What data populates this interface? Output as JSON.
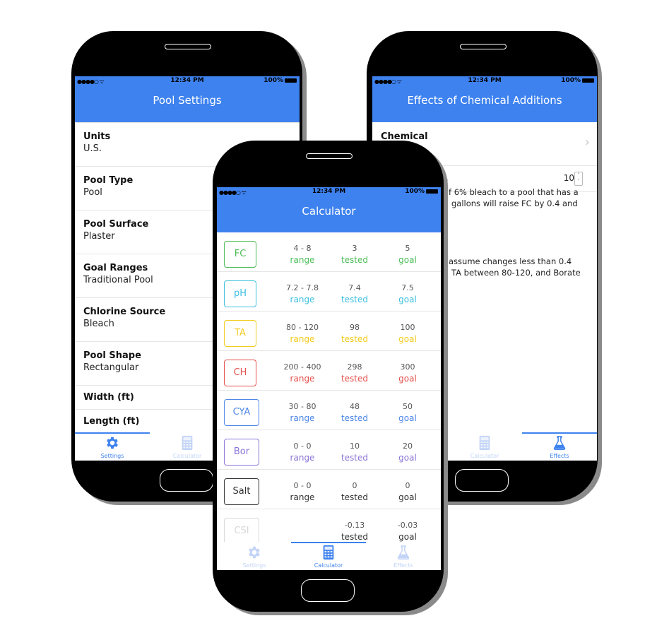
{
  "status_bar": {
    "signal": "●●●●○ ᯤ",
    "time": "12:34 PM",
    "battery": "100%"
  },
  "colors": {
    "accent": "#3e82ef",
    "fc": "#4cbd58",
    "ph": "#3bbfe0",
    "ta": "#f2cb1d",
    "ch": "#e4504b",
    "cya": "#4d86e8",
    "bor": "#8b74d6",
    "salt": "#333333",
    "csi": "#d8d8d8"
  },
  "settings_screen": {
    "title": "Pool Settings",
    "items": [
      {
        "label": "Units",
        "value": "U.S."
      },
      {
        "label": "Pool Type",
        "value": "Pool"
      },
      {
        "label": "Pool Surface",
        "value": "Plaster"
      },
      {
        "label": "Goal Ranges",
        "value": "Traditional Pool"
      },
      {
        "label": "Chlorine Source",
        "value": "Bleach"
      },
      {
        "label": "Pool Shape",
        "value": "Rectangular"
      },
      {
        "label": "Width (ft)",
        "value": ""
      },
      {
        "label": "Length (ft)",
        "value": ""
      }
    ],
    "tabs": [
      {
        "label": "Settings",
        "icon": "gear-icon",
        "active": true
      },
      {
        "label": "Calculator",
        "icon": "calculator-icon",
        "active": false
      }
    ]
  },
  "effects_screen": {
    "title": "Effects of Chemical Additions",
    "chemical_label": "Chemical",
    "amount_suffix": ".",
    "amount_value": "10",
    "paragraph1": [
      "f 6% bleach to a pool that has a",
      "gallons will raise FC by 0.4 and"
    ],
    "paragraph2": [
      "assume changes less than 0.4",
      "TA between 80-120, and Borate"
    ],
    "tabs": [
      {
        "label": "Calculator",
        "icon": "calculator-icon",
        "active": false
      },
      {
        "label": "Effects",
        "icon": "flask-icon",
        "active": true
      }
    ]
  },
  "calculator_screen": {
    "title": "Calculator",
    "rows": [
      {
        "name": "FC",
        "range": "4 - 8",
        "tested": "3",
        "goal": "5",
        "range_label": "range",
        "tested_label": "tested",
        "goal_label": "goal"
      },
      {
        "name": "pH",
        "range": "7.2 - 7.8",
        "tested": "7.4",
        "goal": "7.5",
        "range_label": "range",
        "tested_label": "tested",
        "goal_label": "goal"
      },
      {
        "name": "TA",
        "range": "80 - 120",
        "tested": "98",
        "goal": "100",
        "range_label": "range",
        "tested_label": "tested",
        "goal_label": "goal"
      },
      {
        "name": "CH",
        "range": "200 - 400",
        "tested": "298",
        "goal": "300",
        "range_label": "range",
        "tested_label": "tested",
        "goal_label": "goal"
      },
      {
        "name": "CYA",
        "range": "30 - 80",
        "tested": "48",
        "goal": "50",
        "range_label": "range",
        "tested_label": "tested",
        "goal_label": "goal"
      },
      {
        "name": "Bor",
        "range": "0 - 0",
        "tested": "10",
        "goal": "20",
        "range_label": "range",
        "tested_label": "tested",
        "goal_label": "goal"
      },
      {
        "name": "Salt",
        "range": "0 - 0",
        "tested": "0",
        "goal": "0",
        "range_label": "range",
        "tested_label": "tested",
        "goal_label": "goal"
      },
      {
        "name": "CSI",
        "range": "",
        "tested": "-0.13",
        "goal": "-0.03",
        "range_label": "",
        "tested_label": "tested",
        "goal_label": "goal"
      }
    ],
    "tabs": [
      {
        "label": "Settings",
        "icon": "gear-icon",
        "active": false
      },
      {
        "label": "Calculator",
        "icon": "calculator-icon",
        "active": true
      },
      {
        "label": "Effects",
        "icon": "flask-icon",
        "active": false
      }
    ]
  }
}
